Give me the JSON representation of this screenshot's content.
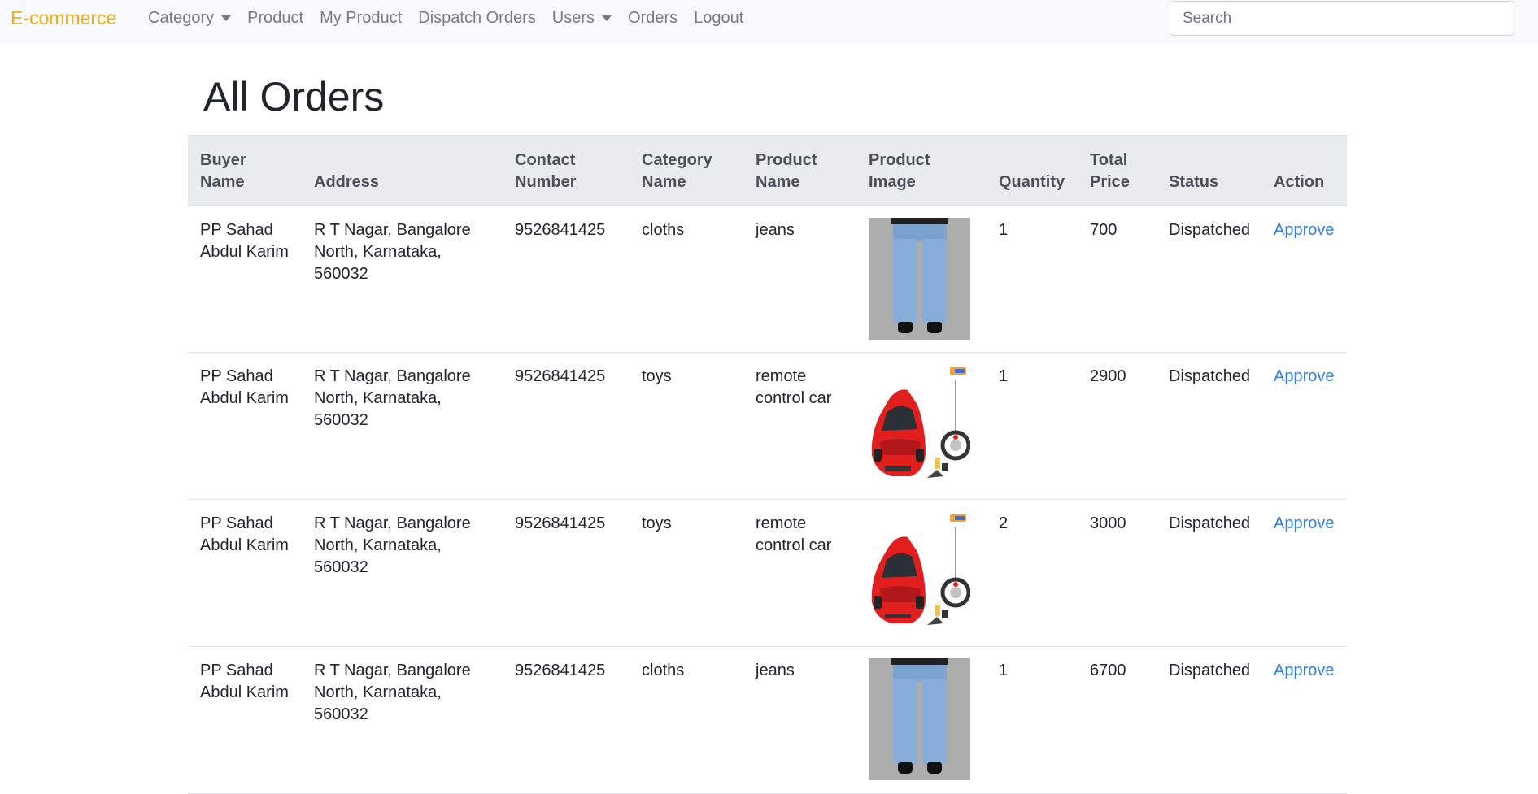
{
  "navbar": {
    "brand": "E-commerce",
    "links": [
      {
        "label": "Category",
        "dropdown": true
      },
      {
        "label": "Product",
        "dropdown": false
      },
      {
        "label": "My Product",
        "dropdown": false
      },
      {
        "label": "Dispatch Orders",
        "dropdown": false
      },
      {
        "label": "Users",
        "dropdown": true
      },
      {
        "label": "Orders",
        "dropdown": false
      },
      {
        "label": "Logout",
        "dropdown": false
      }
    ],
    "search_placeholder": "Search"
  },
  "page": {
    "title": "All Orders"
  },
  "table": {
    "headers": {
      "buyer_name": "Buyer Name",
      "address": "Address",
      "contact_number": "Contact Number",
      "category_name": "Category Name",
      "product_name": "Product Name",
      "product_image": "Product Image",
      "quantity": "Quantity",
      "total_price": "Total Price",
      "status": "Status",
      "action": "Action"
    },
    "rows": [
      {
        "buyer_name": "PP Sahad Abdul Karim",
        "address": "R T Nagar, Bangalore North, Karnataka, 560032",
        "contact_number": "9526841425",
        "category_name": "cloths",
        "product_name": "jeans",
        "product_image": "jeans",
        "quantity": "1",
        "total_price": "700",
        "status": "Dispatched",
        "action": "Approve"
      },
      {
        "buyer_name": "PP Sahad Abdul Karim",
        "address": "R T Nagar, Bangalore North, Karnataka, 560032",
        "contact_number": "9526841425",
        "category_name": "toys",
        "product_name": "remote control car",
        "product_image": "remote-car",
        "quantity": "1",
        "total_price": "2900",
        "status": "Dispatched",
        "action": "Approve"
      },
      {
        "buyer_name": "PP Sahad Abdul Karim",
        "address": "R T Nagar, Bangalore North, Karnataka, 560032",
        "contact_number": "9526841425",
        "category_name": "toys",
        "product_name": "remote control car",
        "product_image": "remote-car",
        "quantity": "2",
        "total_price": "3000",
        "status": "Dispatched",
        "action": "Approve"
      },
      {
        "buyer_name": "PP Sahad Abdul Karim",
        "address": "R T Nagar, Bangalore North, Karnataka, 560032",
        "contact_number": "9526841425",
        "category_name": "cloths",
        "product_name": "jeans",
        "product_image": "jeans",
        "quantity": "1",
        "total_price": "6700",
        "status": "Dispatched",
        "action": "Approve"
      }
    ]
  },
  "colors": {
    "brand": "#f0ad1c",
    "navbar_bg": "#f8f9fa",
    "link": "#2f80e3",
    "table_head_bg": "#e9ecef"
  }
}
